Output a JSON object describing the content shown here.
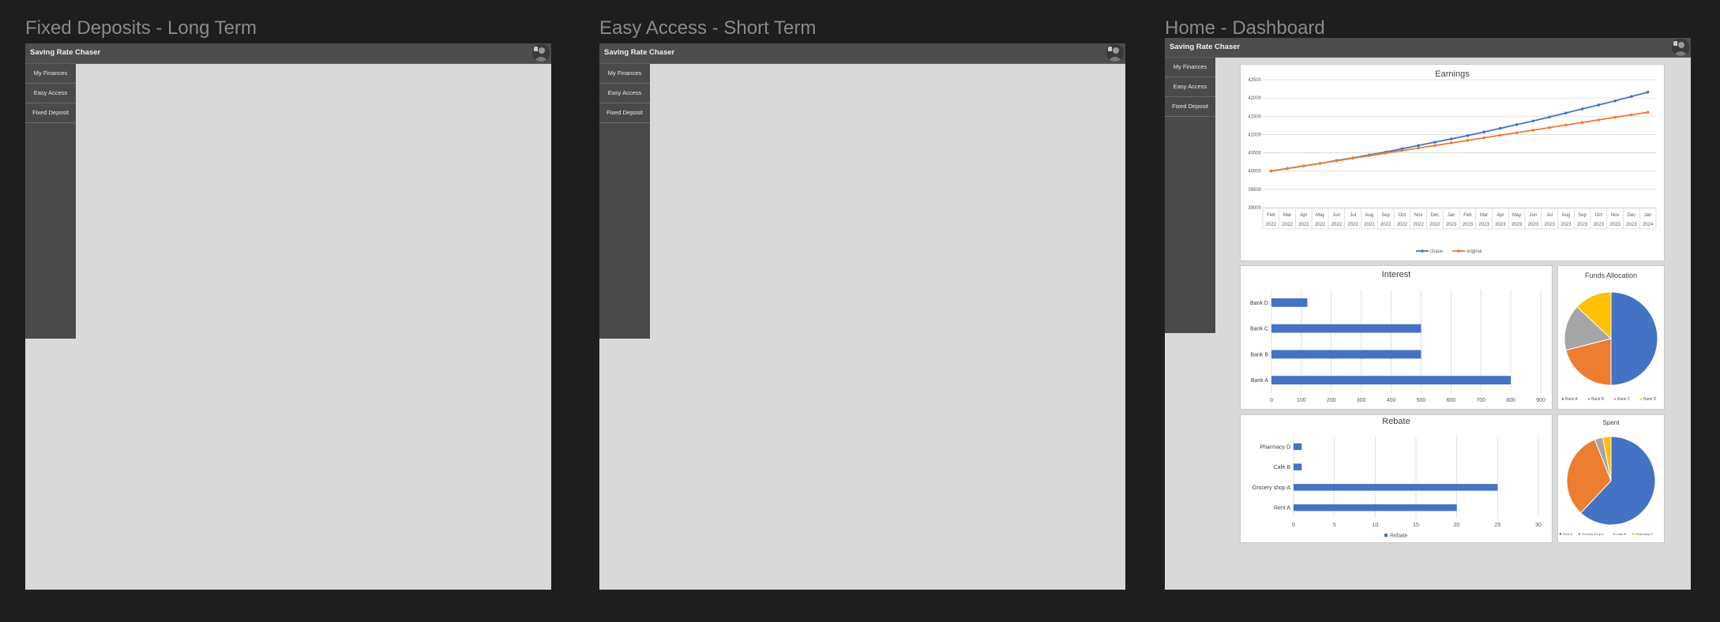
{
  "frames": [
    {
      "title": "Fixed Deposits - Long Term"
    },
    {
      "title": "Easy Access - Short Term"
    },
    {
      "title": "Home - Dashboard"
    }
  ],
  "app": {
    "title": "Saving Rate Chaser",
    "nav": [
      "My Finances",
      "Easy Access",
      "Fixed Deposit"
    ]
  },
  "colors": {
    "blue": "#4472c4",
    "orange": "#ed7d31",
    "gray": "#a5a5a5",
    "yellow": "#ffc000"
  },
  "chart_data": [
    {
      "type": "line",
      "title": "Earnings",
      "x": [
        "Feb 2022",
        "Mar 2022",
        "Apr 2022",
        "May 2022",
        "Jun 2022",
        "Jul 2022",
        "Aug 2022",
        "Sep 2022",
        "Oct 2022",
        "Nov 2022",
        "Dec 2022",
        "Jan 2023",
        "Feb 2023",
        "Mar 2023",
        "Apr 2023",
        "May 2023",
        "Jun 2023",
        "Jul 2023",
        "Aug 2023",
        "Sep 2023",
        "Oct 2023",
        "Nov 2023",
        "Dec 2023",
        "Jan 2024"
      ],
      "x_month": [
        "Feb",
        "Mar",
        "Apr",
        "May",
        "Jun",
        "Jul",
        "Aug",
        "Sep",
        "Oct",
        "Nov",
        "Dec",
        "Jan",
        "Feb",
        "Mar",
        "Apr",
        "May",
        "Jun",
        "Jul",
        "Aug",
        "Sep",
        "Oct",
        "Nov",
        "Dec",
        "Jan"
      ],
      "x_year": [
        "2022",
        "2022",
        "2022",
        "2022",
        "2022",
        "2022",
        "2022",
        "2022",
        "2022",
        "2022",
        "2022",
        "2023",
        "2023",
        "2023",
        "2023",
        "2023",
        "2023",
        "2023",
        "2023",
        "2023",
        "2023",
        "2023",
        "2023",
        "2024"
      ],
      "series": [
        {
          "name": "chase",
          "color": "#4472c4",
          "values": [
            40000,
            40070,
            40140,
            40210,
            40290,
            40360,
            40440,
            40520,
            40610,
            40700,
            40790,
            40880,
            40970,
            41070,
            41170,
            41270,
            41370,
            41480,
            41590,
            41700,
            41810,
            41920,
            42040,
            42160
          ]
        },
        {
          "name": "original",
          "color": "#ed7d31",
          "values": [
            40000,
            40070,
            40140,
            40210,
            40280,
            40350,
            40420,
            40490,
            40560,
            40630,
            40700,
            40770,
            40840,
            40910,
            40980,
            41050,
            41120,
            41190,
            41260,
            41330,
            41400,
            41470,
            41540,
            41610
          ]
        }
      ],
      "yticks": [
        39000,
        39500,
        40000,
        40500,
        41000,
        41500,
        42000,
        42500
      ],
      "ylim": [
        39000,
        42500
      ],
      "legend": "bottom",
      "grid": true
    },
    {
      "type": "bar",
      "orientation": "horizontal",
      "title": "Interest",
      "categories": [
        "Bank A",
        "Bank B",
        "Bank C",
        "Bank D"
      ],
      "values": [
        800,
        500,
        500,
        120
      ],
      "xticks": [
        0,
        100,
        200,
        300,
        400,
        500,
        600,
        700,
        800,
        900
      ],
      "xlim": [
        0,
        900
      ],
      "grid": true
    },
    {
      "type": "pie",
      "title": "Funds Allocation",
      "labels": [
        "Bank A",
        "Bank B",
        "Bank C",
        "Bank D"
      ],
      "values": [
        50,
        21,
        16,
        13
      ],
      "colors": [
        "#4472c4",
        "#ed7d31",
        "#a5a5a5",
        "#ffc000"
      ],
      "legend": "bottom"
    },
    {
      "type": "bar",
      "orientation": "horizontal",
      "title": "Rebate",
      "categories": [
        "Rent A",
        "Grocery shop A",
        "Café B",
        "Pharmacy D"
      ],
      "values": [
        20,
        25,
        1,
        1
      ],
      "xticks": [
        0,
        5,
        10,
        15,
        20,
        25,
        30
      ],
      "xlim": [
        0,
        30
      ],
      "series_name": "Rebate",
      "legend": "bottom",
      "grid": true
    },
    {
      "type": "pie",
      "title": "Spent",
      "labels": [
        "Rent A",
        "Grocery shop A",
        "Café B",
        "Pharmacy D"
      ],
      "values": [
        62,
        32,
        3,
        3
      ],
      "colors": [
        "#4472c4",
        "#ed7d31",
        "#a5a5a5",
        "#ffc000"
      ],
      "legend": "bottom"
    }
  ]
}
